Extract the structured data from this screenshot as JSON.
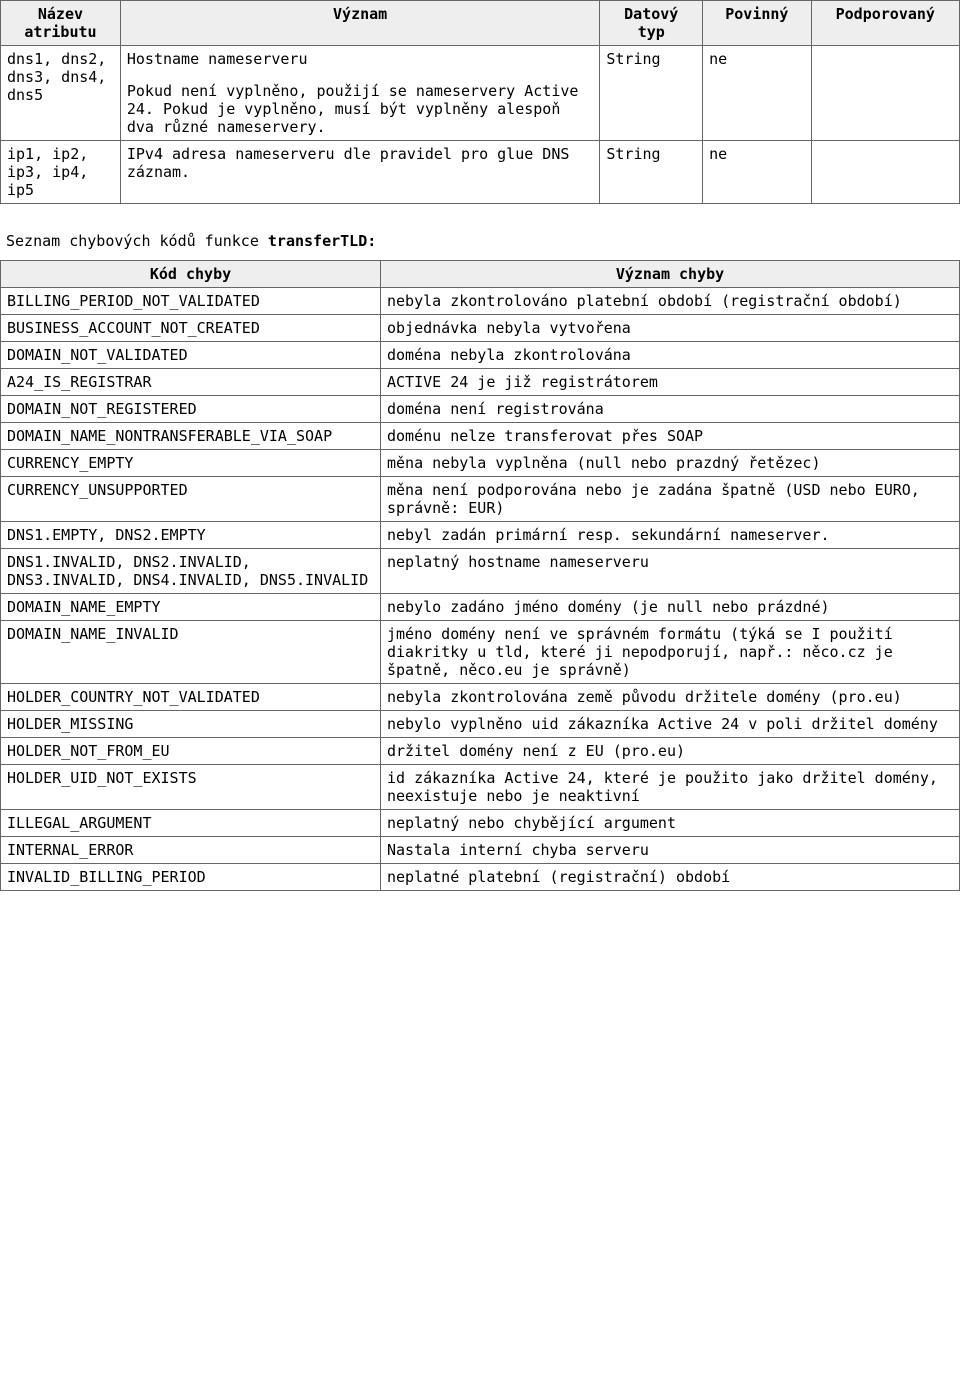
{
  "table1": {
    "headers": {
      "name": "Název atributu",
      "meaning": "Význam",
      "dtype": "Datový typ",
      "required": "Povinný",
      "supported": "Podporovaný"
    },
    "rows": [
      {
        "name": "dns1, dns2, dns3, dns4, dns5",
        "meaning_p1": "Hostname nameserveru",
        "meaning_p2": "Pokud není vyplněno, použijí se nameservery Active 24. Pokud je vyplněno, musí být vyplněny alespoň dva různé nameservery.",
        "dtype": "String",
        "required": "ne",
        "supported": ""
      },
      {
        "name": "ip1, ip2, ip3, ip4, ip5",
        "meaning_p1": "IPv4 adresa nameserveru dle pravidel pro glue DNS záznam.",
        "meaning_p2": "",
        "dtype": "String",
        "required": "ne",
        "supported": ""
      }
    ]
  },
  "section_label_prefix": "Seznam chybových kódů funkce ",
  "section_label_bold": "transferTLD:",
  "table2": {
    "headers": {
      "code": "Kód chyby",
      "meaning": "Význam chyby"
    },
    "rows": [
      {
        "code": "BILLING_PERIOD_NOT_VALIDATED",
        "meaning": "nebyla zkontrolováno platební období (registrační období)"
      },
      {
        "code": "BUSINESS_ACCOUNT_NOT_CREATED",
        "meaning": "objednávka nebyla vytvořena"
      },
      {
        "code": "DOMAIN_NOT_VALIDATED",
        "meaning": "doména nebyla zkontrolována"
      },
      {
        "code": "A24_IS_REGISTRAR",
        "meaning": "ACTIVE 24 je již registrátorem"
      },
      {
        "code": "DOMAIN_NOT_REGISTERED",
        "meaning": "doména není registrována"
      },
      {
        "code": "DOMAIN_NAME_NONTRANSFERABLE_VIA_SOAP",
        "meaning": "doménu nelze transferovat přes SOAP"
      },
      {
        "code": "CURRENCY_EMPTY",
        "meaning": "měna nebyla vyplněna (null nebo prazdný řetězec)"
      },
      {
        "code": "CURRENCY_UNSUPPORTED",
        "meaning": "měna není podporována nebo je zadána špatně (USD nebo EURO, správně: EUR)"
      },
      {
        "code": "DNS1.EMPTY, DNS2.EMPTY",
        "meaning": "nebyl zadán primární resp. sekundární nameserver."
      },
      {
        "code": "DNS1.INVALID, DNS2.INVALID, DNS3.INVALID, DNS4.INVALID, DNS5.INVALID",
        "meaning": "neplatný hostname nameserveru"
      },
      {
        "code": "DOMAIN_NAME_EMPTY",
        "meaning": "nebylo zadáno jméno domény (je null nebo prázdné)"
      },
      {
        "code": "DOMAIN_NAME_INVALID",
        "meaning": "jméno domény není ve správném formátu (týká se I použití diakritky u tld, které ji nepodporují, např.: něco.cz je špatně, něco.eu je správně)"
      },
      {
        "code": "HOLDER_COUNTRY_NOT_VALIDATED",
        "meaning": "nebyla zkontrolována země původu držitele domény (pro.eu)"
      },
      {
        "code": "HOLDER_MISSING",
        "meaning": "nebylo vyplněno uid zákazníka Active 24 v poli držitel domény"
      },
      {
        "code": "HOLDER_NOT_FROM_EU",
        "meaning": "držitel domény není z EU (pro.eu)"
      },
      {
        "code": "HOLDER_UID_NOT_EXISTS",
        "meaning": "id zákazníka Active 24, které je použito jako držitel domény, neexistuje nebo je neaktivní"
      },
      {
        "code": "ILLEGAL_ARGUMENT",
        "meaning": "neplatný nebo chybějící argument"
      },
      {
        "code": "INTERNAL_ERROR",
        "meaning": "Nastala interní chyba serveru"
      },
      {
        "code": "INVALID_BILLING_PERIOD",
        "meaning": "neplatné platební (registrační) období"
      }
    ]
  }
}
